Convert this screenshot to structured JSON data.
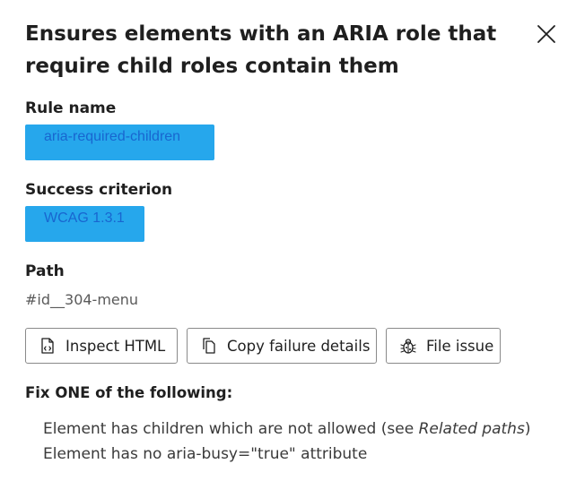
{
  "dialog": {
    "title": "Ensures elements with an ARIA role that require child roles contain them",
    "close_icon": "close-icon"
  },
  "rule": {
    "label": "Rule name",
    "value": "aria-required-children"
  },
  "criterion": {
    "label": "Success criterion",
    "value": "WCAG 1.3.1"
  },
  "path": {
    "label": "Path",
    "value": "#id__304-menu"
  },
  "actions": {
    "inspect": {
      "label": "Inspect HTML",
      "icon": "inspect-html-icon"
    },
    "copy": {
      "label": "Copy failure details",
      "icon": "copy-icon"
    },
    "file": {
      "label": "File issue",
      "icon": "bug-icon"
    }
  },
  "fix": {
    "heading": "Fix ONE of the following:",
    "item1_prefix": "Element has children which are not allowed (see ",
    "item1_link": "Related paths",
    "item1_suffix": ")",
    "item2": "Element has no aria-busy=\"true\" attribute"
  },
  "colors": {
    "chip_background": "#26a7ec",
    "chip_text": "#1866d0",
    "border": "#8a8a8a",
    "text": "#1f1f1f"
  }
}
